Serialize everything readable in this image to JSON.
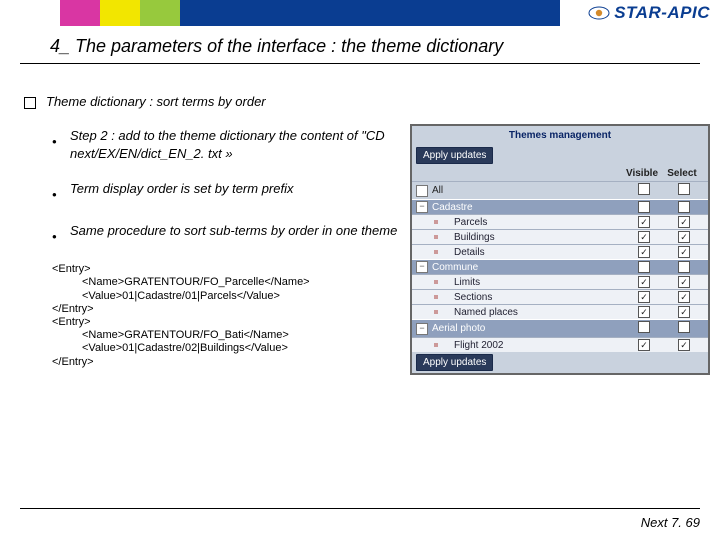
{
  "brand": "STAR-APIC",
  "title": "4_ The parameters of the interface : the theme dictionary",
  "main_bullet": "Theme dictionary : sort terms by order",
  "steps": [
    "Step 2 : add to the theme dictionary the content of \"CD next/EX/EN/dict_EN_2. txt »",
    "Term display order is set by term prefix",
    "Same procedure to sort sub-terms by order in one theme"
  ],
  "code": [
    "<Entry>",
    "  <Name>GRATENTOUR/FO_Parcelle</Name>",
    "  <Value>01|Cadastre/01|Parcels</Value>",
    "</Entry>",
    "<Entry>",
    "  <Name>GRATENTOUR/FO_Bati</Name>",
    "  <Value>01|Cadastre/02|Buildings</Value>",
    "</Entry>"
  ],
  "panel": {
    "header": "Themes management",
    "apply": "Apply updates",
    "cols": {
      "visible": "Visible",
      "select": "Select"
    },
    "rows": [
      {
        "type": "all",
        "label": "All",
        "visible": false,
        "select": false
      },
      {
        "type": "group",
        "label": "Cadastre",
        "visible": true,
        "select": true
      },
      {
        "type": "child",
        "label": "Parcels",
        "visible": true,
        "select": true
      },
      {
        "type": "child",
        "label": "Buildings",
        "visible": true,
        "select": true
      },
      {
        "type": "child",
        "label": "Details",
        "visible": true,
        "select": true
      },
      {
        "type": "group",
        "label": "Commune",
        "visible": true,
        "select": true
      },
      {
        "type": "child",
        "label": "Limits",
        "visible": true,
        "select": true
      },
      {
        "type": "child",
        "label": "Sections",
        "visible": true,
        "select": true
      },
      {
        "type": "child",
        "label": "Named places",
        "visible": true,
        "select": true
      },
      {
        "type": "group",
        "label": "Aerial photo",
        "visible": false,
        "select": false
      },
      {
        "type": "child",
        "label": "Flight 2002",
        "visible": true,
        "select": true
      }
    ]
  },
  "footer": "Next 7. 69"
}
